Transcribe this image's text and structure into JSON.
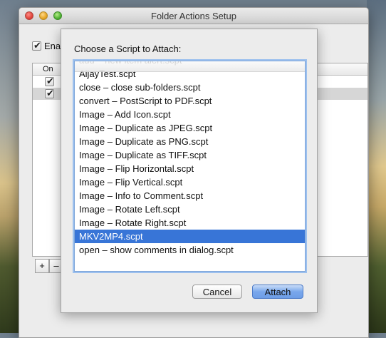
{
  "window": {
    "title": "Folder Actions Setup",
    "enable_label": "Ena",
    "table_header_on": "On",
    "add_label": "+",
    "remove_label": "–"
  },
  "sheet": {
    "prompt": "Choose a Script to Attach:",
    "scripts": [
      "add – new item alert.scpt",
      "AijayTest.scpt",
      "close – close sub-folders.scpt",
      "convert – PostScript to PDF.scpt",
      "Image – Add Icon.scpt",
      "Image – Duplicate as JPEG.scpt",
      "Image – Duplicate as PNG.scpt",
      "Image – Duplicate as TIFF.scpt",
      "Image – Flip Horizontal.scpt",
      "Image – Flip Vertical.scpt",
      "Image – Info to Comment.scpt",
      "Image – Rotate Left.scpt",
      "Image – Rotate Right.scpt",
      "MKV2MP4.scpt",
      "open – show comments in dialog.scpt"
    ],
    "selected_index": 13,
    "cancel_label": "Cancel",
    "attach_label": "Attach"
  },
  "colors": {
    "selection": "#3875d7",
    "focus_ring": "#9cc0ee"
  }
}
